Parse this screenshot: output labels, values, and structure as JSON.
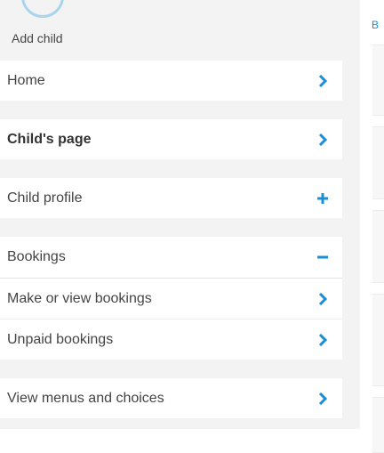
{
  "header": {
    "add_child_label": "Add child"
  },
  "sidebar": {
    "items": [
      {
        "label": "Home",
        "icon": "chevron-right-icon"
      },
      {
        "label": "Child's page",
        "icon": "chevron-right-icon"
      },
      {
        "label": "Child profile",
        "icon": "plus-icon"
      },
      {
        "label": "Bookings",
        "icon": "minus-icon"
      },
      {
        "label": "Make or view bookings",
        "icon": "chevron-right-icon"
      },
      {
        "label": "Unpaid bookings",
        "icon": "chevron-right-icon"
      },
      {
        "label": "View menus and choices",
        "icon": "chevron-right-icon"
      }
    ]
  },
  "main": {
    "breadcrumb_fragment": "B"
  },
  "colors": {
    "accent": "#1b8fd6",
    "sidebar_bg": "#f3f3f3",
    "avatar_ring": "#a8d4ec"
  }
}
